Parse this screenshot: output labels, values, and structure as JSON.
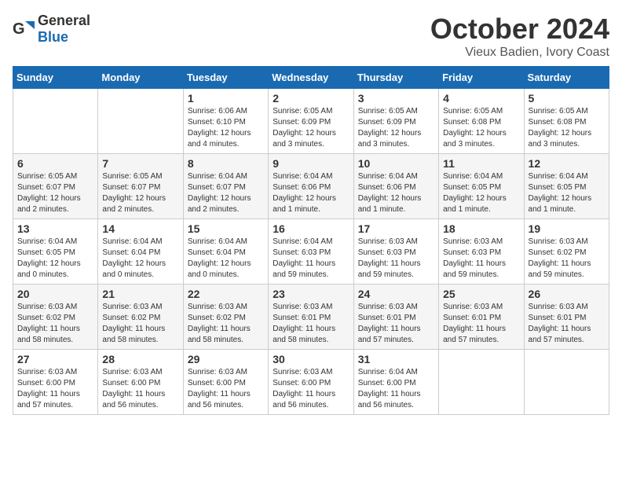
{
  "header": {
    "logo_general": "General",
    "logo_blue": "Blue",
    "month_title": "October 2024",
    "location": "Vieux Badien, Ivory Coast"
  },
  "days_of_week": [
    "Sunday",
    "Monday",
    "Tuesday",
    "Wednesday",
    "Thursday",
    "Friday",
    "Saturday"
  ],
  "weeks": [
    [
      {
        "day": null,
        "info": null
      },
      {
        "day": null,
        "info": null
      },
      {
        "day": "1",
        "info": "Sunrise: 6:06 AM\nSunset: 6:10 PM\nDaylight: 12 hours and 4 minutes."
      },
      {
        "day": "2",
        "info": "Sunrise: 6:05 AM\nSunset: 6:09 PM\nDaylight: 12 hours and 3 minutes."
      },
      {
        "day": "3",
        "info": "Sunrise: 6:05 AM\nSunset: 6:09 PM\nDaylight: 12 hours and 3 minutes."
      },
      {
        "day": "4",
        "info": "Sunrise: 6:05 AM\nSunset: 6:08 PM\nDaylight: 12 hours and 3 minutes."
      },
      {
        "day": "5",
        "info": "Sunrise: 6:05 AM\nSunset: 6:08 PM\nDaylight: 12 hours and 3 minutes."
      }
    ],
    [
      {
        "day": "6",
        "info": "Sunrise: 6:05 AM\nSunset: 6:07 PM\nDaylight: 12 hours and 2 minutes."
      },
      {
        "day": "7",
        "info": "Sunrise: 6:05 AM\nSunset: 6:07 PM\nDaylight: 12 hours and 2 minutes."
      },
      {
        "day": "8",
        "info": "Sunrise: 6:04 AM\nSunset: 6:07 PM\nDaylight: 12 hours and 2 minutes."
      },
      {
        "day": "9",
        "info": "Sunrise: 6:04 AM\nSunset: 6:06 PM\nDaylight: 12 hours and 1 minute."
      },
      {
        "day": "10",
        "info": "Sunrise: 6:04 AM\nSunset: 6:06 PM\nDaylight: 12 hours and 1 minute."
      },
      {
        "day": "11",
        "info": "Sunrise: 6:04 AM\nSunset: 6:05 PM\nDaylight: 12 hours and 1 minute."
      },
      {
        "day": "12",
        "info": "Sunrise: 6:04 AM\nSunset: 6:05 PM\nDaylight: 12 hours and 1 minute."
      }
    ],
    [
      {
        "day": "13",
        "info": "Sunrise: 6:04 AM\nSunset: 6:05 PM\nDaylight: 12 hours and 0 minutes."
      },
      {
        "day": "14",
        "info": "Sunrise: 6:04 AM\nSunset: 6:04 PM\nDaylight: 12 hours and 0 minutes."
      },
      {
        "day": "15",
        "info": "Sunrise: 6:04 AM\nSunset: 6:04 PM\nDaylight: 12 hours and 0 minutes."
      },
      {
        "day": "16",
        "info": "Sunrise: 6:04 AM\nSunset: 6:03 PM\nDaylight: 11 hours and 59 minutes."
      },
      {
        "day": "17",
        "info": "Sunrise: 6:03 AM\nSunset: 6:03 PM\nDaylight: 11 hours and 59 minutes."
      },
      {
        "day": "18",
        "info": "Sunrise: 6:03 AM\nSunset: 6:03 PM\nDaylight: 11 hours and 59 minutes."
      },
      {
        "day": "19",
        "info": "Sunrise: 6:03 AM\nSunset: 6:02 PM\nDaylight: 11 hours and 59 minutes."
      }
    ],
    [
      {
        "day": "20",
        "info": "Sunrise: 6:03 AM\nSunset: 6:02 PM\nDaylight: 11 hours and 58 minutes."
      },
      {
        "day": "21",
        "info": "Sunrise: 6:03 AM\nSunset: 6:02 PM\nDaylight: 11 hours and 58 minutes."
      },
      {
        "day": "22",
        "info": "Sunrise: 6:03 AM\nSunset: 6:02 PM\nDaylight: 11 hours and 58 minutes."
      },
      {
        "day": "23",
        "info": "Sunrise: 6:03 AM\nSunset: 6:01 PM\nDaylight: 11 hours and 58 minutes."
      },
      {
        "day": "24",
        "info": "Sunrise: 6:03 AM\nSunset: 6:01 PM\nDaylight: 11 hours and 57 minutes."
      },
      {
        "day": "25",
        "info": "Sunrise: 6:03 AM\nSunset: 6:01 PM\nDaylight: 11 hours and 57 minutes."
      },
      {
        "day": "26",
        "info": "Sunrise: 6:03 AM\nSunset: 6:01 PM\nDaylight: 11 hours and 57 minutes."
      }
    ],
    [
      {
        "day": "27",
        "info": "Sunrise: 6:03 AM\nSunset: 6:00 PM\nDaylight: 11 hours and 57 minutes."
      },
      {
        "day": "28",
        "info": "Sunrise: 6:03 AM\nSunset: 6:00 PM\nDaylight: 11 hours and 56 minutes."
      },
      {
        "day": "29",
        "info": "Sunrise: 6:03 AM\nSunset: 6:00 PM\nDaylight: 11 hours and 56 minutes."
      },
      {
        "day": "30",
        "info": "Sunrise: 6:03 AM\nSunset: 6:00 PM\nDaylight: 11 hours and 56 minutes."
      },
      {
        "day": "31",
        "info": "Sunrise: 6:04 AM\nSunset: 6:00 PM\nDaylight: 11 hours and 56 minutes."
      },
      {
        "day": null,
        "info": null
      },
      {
        "day": null,
        "info": null
      }
    ]
  ]
}
